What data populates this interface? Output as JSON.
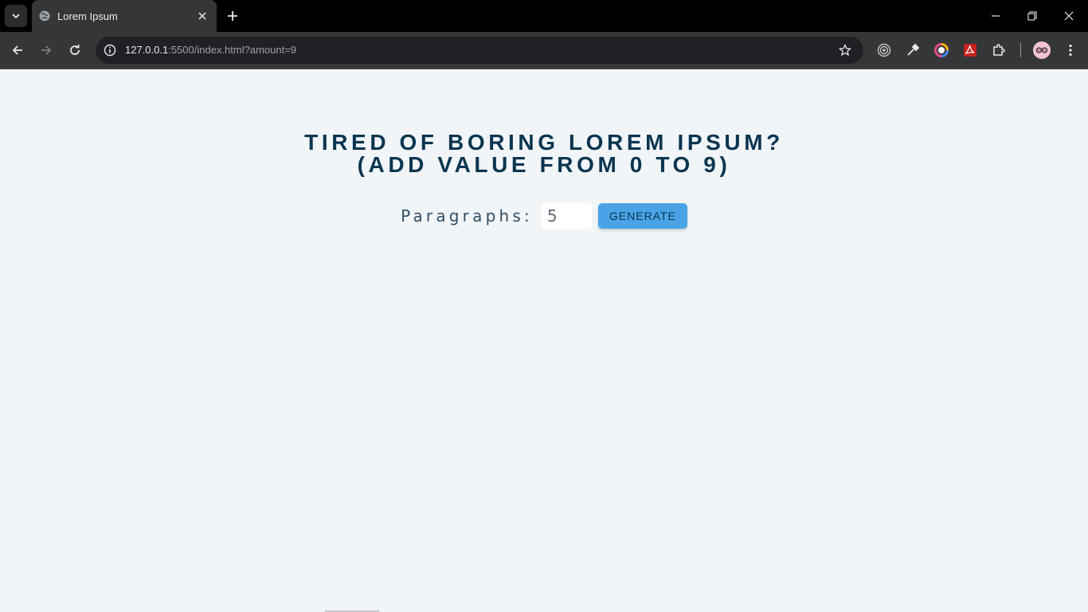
{
  "browser": {
    "tab_title": "Lorem Ipsum",
    "url_host": "127.0.0.1",
    "url_rest": ":5500/index.html?amount=9",
    "icons": {
      "tab_search": "chevron-down-icon",
      "favicon": "globe-icon",
      "tab_close": "close-icon",
      "new_tab": "plus-icon",
      "minimize": "minimize-icon",
      "restore": "restore-icon",
      "close_window": "close-icon",
      "back": "arrow-left-icon",
      "forward": "arrow-right-icon",
      "reload": "reload-icon",
      "site_info": "info-icon",
      "bookmark": "star-icon",
      "extensions": [
        "target-icon",
        "eyedropper-icon",
        "color-wheel-icon",
        "pdf-icon",
        "puzzle-icon"
      ],
      "profile": "avatar",
      "menu": "kebab-menu-icon"
    }
  },
  "page": {
    "heading_line1": "TIRED OF BORING LOREM IPSUM?",
    "heading_line2": "(ADD VALUE FROM 0 TO 9)",
    "label": "Paragraphs:",
    "input_value": "5",
    "button_label": "GENERATE"
  },
  "colors": {
    "page_bg": "#f1f5f8",
    "heading": "#0b3550",
    "button_bg": "#4aa3e6"
  }
}
